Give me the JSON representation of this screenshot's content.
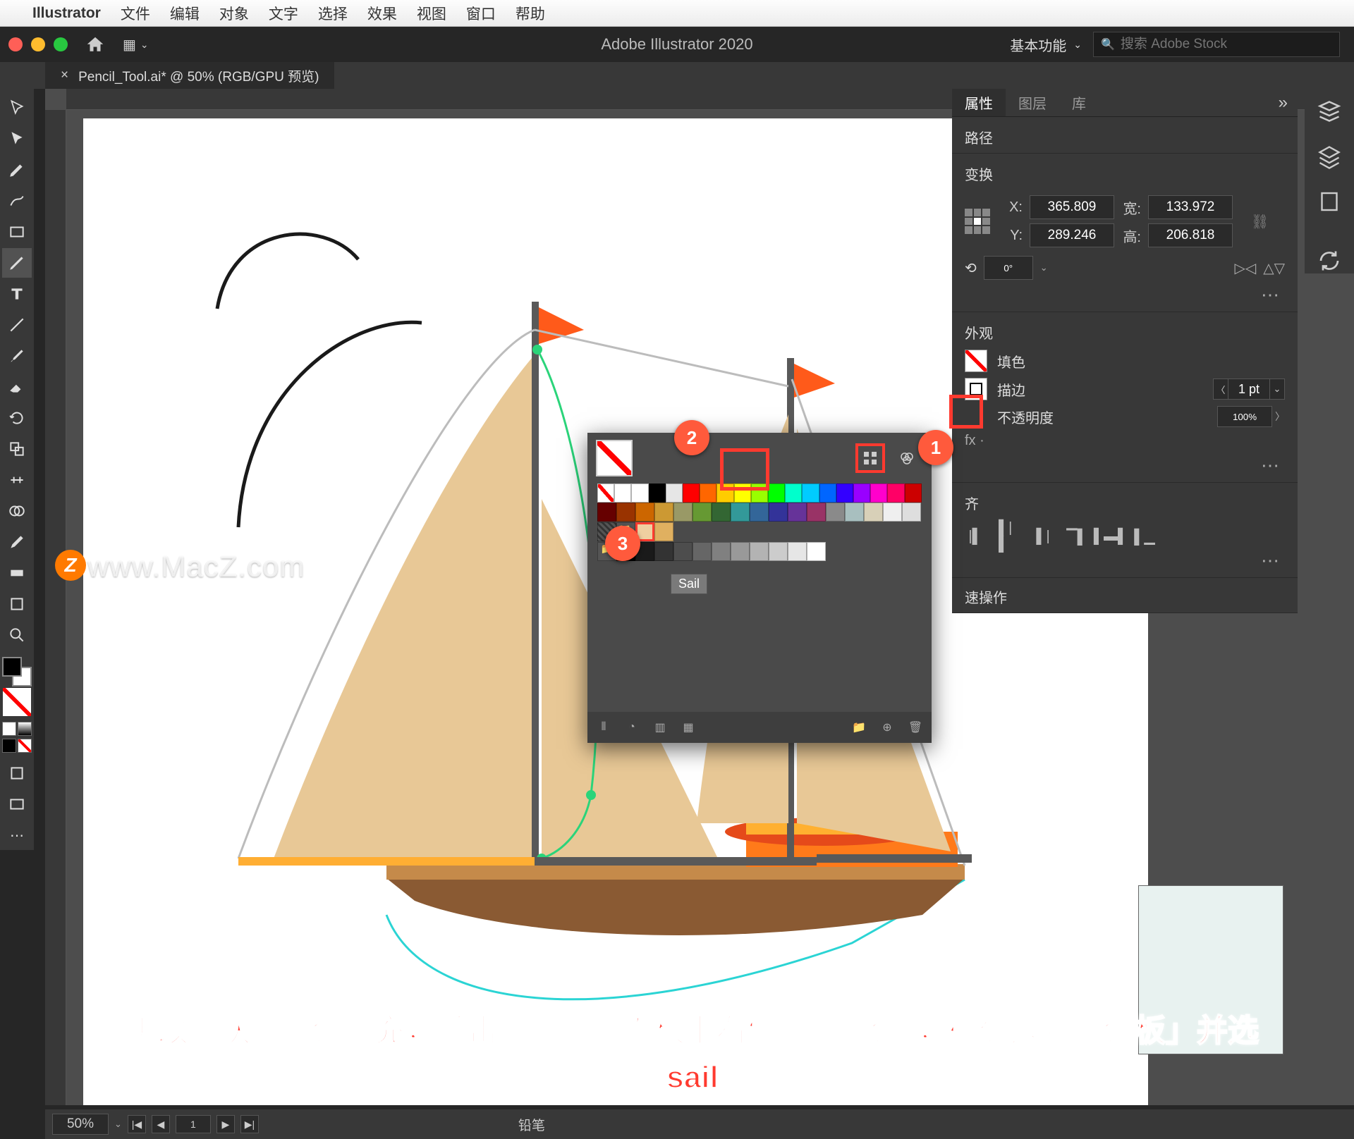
{
  "mac_menu": {
    "app": "Illustrator",
    "items": [
      "文件",
      "编辑",
      "对象",
      "文字",
      "选择",
      "效果",
      "视图",
      "窗口",
      "帮助"
    ]
  },
  "window": {
    "title": "Adobe Illustrator 2020",
    "workspace": "基本功能",
    "search_placeholder": "搜索 Adobe Stock"
  },
  "document_tab": "Pencil_Tool.ai* @ 50% (RGB/GPU 预览)",
  "panel": {
    "tabs": [
      "属性",
      "图层",
      "库"
    ],
    "selection_type": "路径",
    "section_transform": "变换",
    "x_label": "X:",
    "x": "365.809",
    "y_label": "Y:",
    "y": "289.246",
    "w_label": "宽:",
    "w": "133.972",
    "h_label": "高:",
    "h": "206.818",
    "rot": "0°",
    "section_appearance": "外观",
    "fill_label": "填色",
    "stroke_label": "描边",
    "stroke_wt": "1 pt",
    "opacity_label": "不透明度",
    "opacity": "100%",
    "section_align": "齐",
    "quick": "速操作"
  },
  "swatch_tooltip": "Sail",
  "status": {
    "zoom": "50%",
    "tool": "铅笔"
  },
  "watermark": "www.MacZ.com",
  "watermark_badge": "Z",
  "badges": [
    "1",
    "2",
    "3"
  ],
  "caption_l1": "要更改形状的颜色填充，单击「属性」面板中右侧的「填色」，确保选择「色板」并选",
  "caption_l2": "择「sail」",
  "swatch_rows": [
    [
      "#ffffff",
      "#000000",
      "#e6e6e6",
      "#ff0000",
      "#ff6600",
      "#ffcc00",
      "#ffff00",
      "#99ff00",
      "#00ff00",
      "#00ffcc",
      "#00ccff",
      "#0066ff",
      "#3300ff",
      "#9900ff",
      "#ff00cc",
      "#ff0066",
      "#cc0000"
    ],
    [
      "#660000",
      "#993300",
      "#cc6600",
      "#cc9933",
      "#999966",
      "#669933",
      "#336633",
      "#339999",
      "#336699",
      "#333399",
      "#663399",
      "#993366",
      "#8a8a8a",
      "#a8bfbf",
      "#d8d0b8",
      "#efefef",
      "#dedede"
    ],
    [
      "#efcfa0",
      "#e0b060"
    ]
  ],
  "gray_row": [
    "#000",
    "#1a1a1a",
    "#333",
    "#4d4d4d",
    "#666",
    "#808080",
    "#999",
    "#b3b3b3",
    "#ccc",
    "#e6e6e6",
    "#fff"
  ]
}
